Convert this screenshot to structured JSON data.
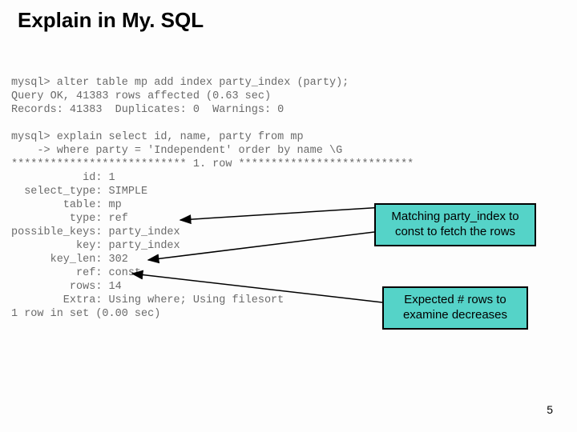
{
  "title": "Explain in My. SQL",
  "terminal": {
    "l0": "mysql> alter table mp add index party_index (party);",
    "l1": "Query OK, 41383 rows affected (0.63 sec)",
    "l2": "Records: 41383  Duplicates: 0  Warnings: 0",
    "l3": "",
    "l4": "mysql> explain select id, name, party from mp",
    "l5": "    -> where party = 'Independent' order by name \\G",
    "l6": "*************************** 1. row ***************************",
    "l7": "           id: 1",
    "l8": "  select_type: SIMPLE",
    "l9": "        table: mp",
    "l10": "         type: ref",
    "l11": "possible_keys: party_index",
    "l12": "          key: party_index",
    "l13": "      key_len: 302",
    "l14": "          ref: const",
    "l15": "         rows: 14",
    "l16": "        Extra: Using where; Using filesort",
    "l17": "1 row in set (0.00 sec)"
  },
  "callouts": {
    "c1_line1": "Matching party_index to",
    "c1_line2": "const to fetch the rows",
    "c2_line1": "Expected # rows to",
    "c2_line2": "examine decreases"
  },
  "page_number": "5"
}
